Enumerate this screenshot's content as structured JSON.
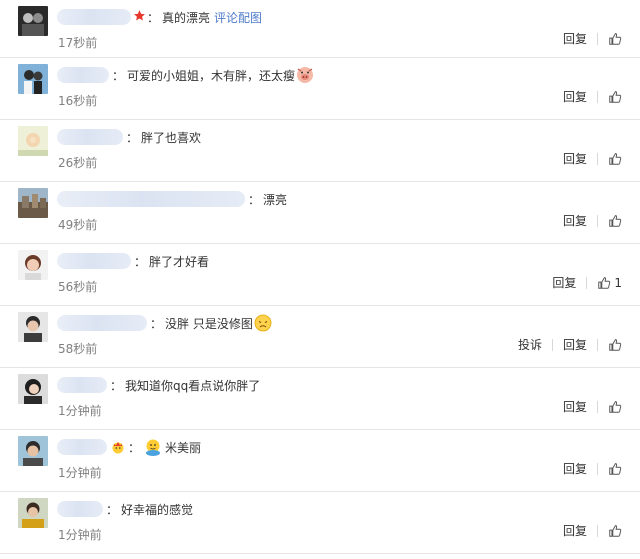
{
  "comments": [
    {
      "text": "真的漂亮",
      "link": "评论配图",
      "time": "17秒前",
      "badge": "star",
      "blur_w": 74
    },
    {
      "text": "可爱的小姐姐，木有胖，还太瘦",
      "emoji": "pig",
      "time": "16秒前",
      "blur_w": 52
    },
    {
      "text": "胖了也喜欢",
      "time": "26秒前",
      "blur_w": 66
    },
    {
      "text": "漂亮",
      "time": "49秒前",
      "blur_w": 188
    },
    {
      "text": "胖了才好看",
      "time": "56秒前",
      "blur_w": 74,
      "likes": "1"
    },
    {
      "text": "没胖 只是没修图",
      "emoji": "sad",
      "time": "58秒前",
      "blur_w": 90,
      "report": true
    },
    {
      "text": "我知道你qq看点说你胖了",
      "time": "1分钟前",
      "blur_w": 50
    },
    {
      "text": "米美丽",
      "emoji_before": "hug",
      "badge": "crown",
      "time": "1分钟前",
      "blur_w": 50
    },
    {
      "text": "好幸福的感觉",
      "time": "1分钟前",
      "blur_w": 46
    }
  ],
  "labels": {
    "reply": "回复",
    "report": "投诉",
    "colon": "："
  },
  "colors": {
    "link": "#4e7bc9",
    "time": "#808080",
    "divider": "#e6e6e6",
    "star": "#e8372c"
  },
  "icons": {
    "like": "thumbs-up-icon",
    "star": "star-icon",
    "crown": "crown-emoji-icon",
    "pig": "pig-emoji-icon",
    "sad": "sad-emoji-icon",
    "hug": "hug-emoji-icon"
  }
}
